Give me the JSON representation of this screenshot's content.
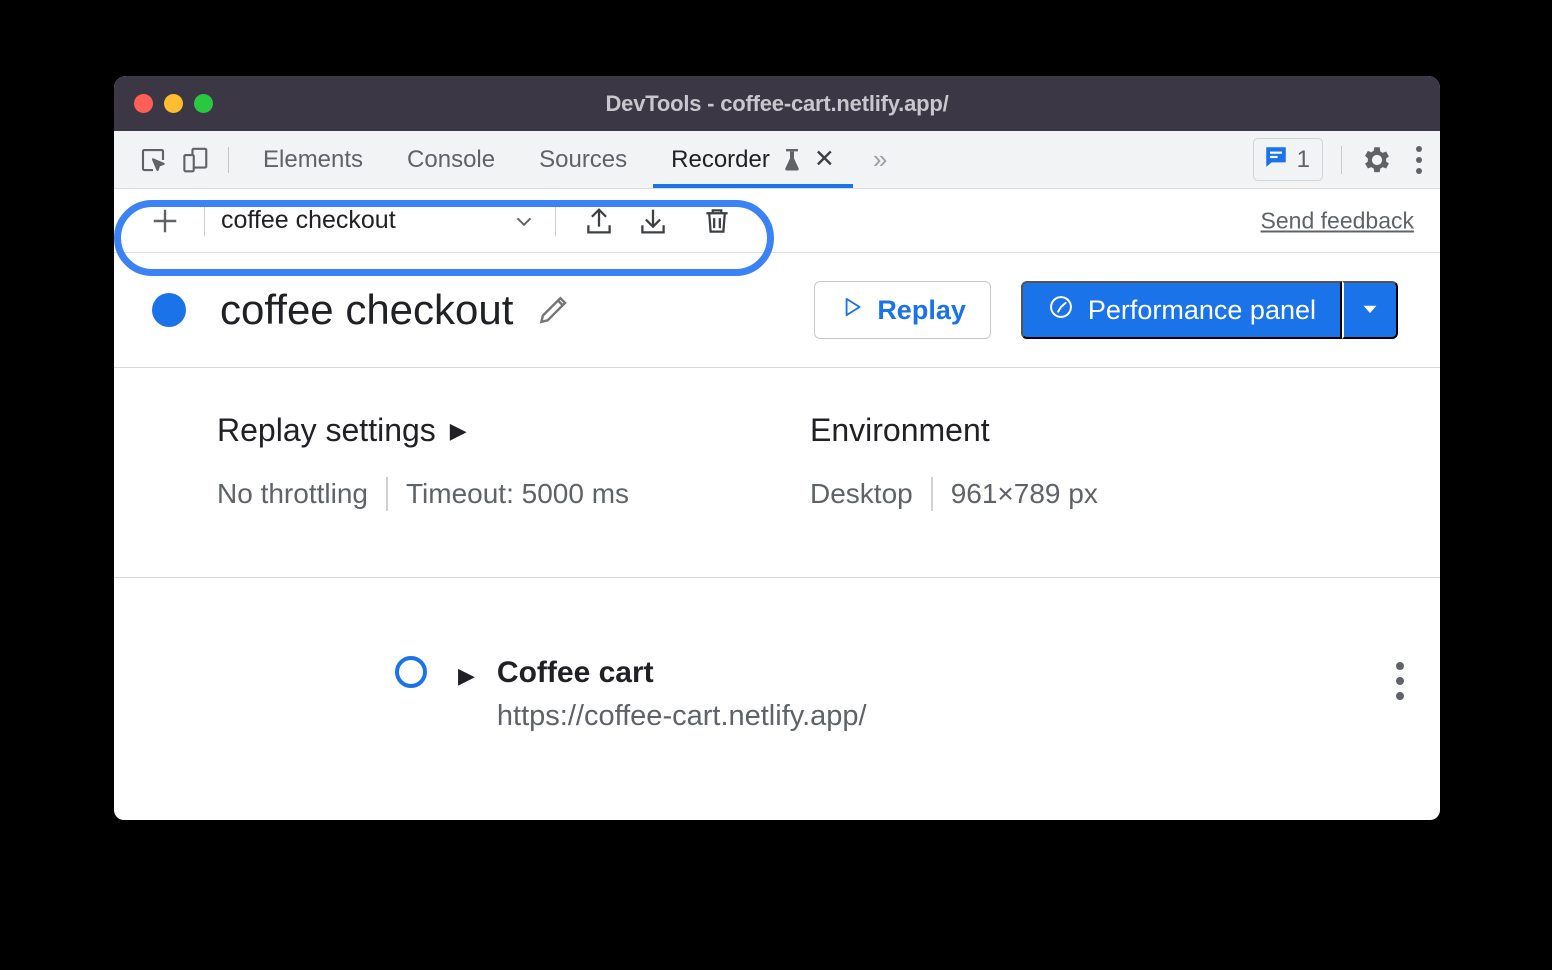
{
  "window": {
    "title": "DevTools - coffee-cart.netlify.app/",
    "traffic_lights": [
      "close",
      "minimize",
      "zoom"
    ]
  },
  "tabbar": {
    "inspect_icon": "inspect-element-icon",
    "device_icon": "device-toolbar-icon",
    "tabs": [
      {
        "label": "Elements",
        "active": false
      },
      {
        "label": "Console",
        "active": false
      },
      {
        "label": "Sources",
        "active": false
      },
      {
        "label": "Recorder",
        "active": true,
        "experimental_icon": "flask-icon",
        "closable": true
      }
    ],
    "close_label": "×",
    "more_tabs_label": "»",
    "messages_count": "1",
    "messages_icon": "message-icon",
    "settings_icon": "gear-icon",
    "more_options_icon": "kebab-menu-icon"
  },
  "recorder_toolbar": {
    "add_label": "+",
    "add_icon": "plus-icon",
    "selected_recording": "coffee checkout",
    "dropdown_icon": "chevron-down-icon",
    "export_icon": "export-upload-icon",
    "import_icon": "import-download-icon",
    "delete_icon": "trash-icon",
    "feedback_label": "Send feedback",
    "highlight_color": "#3b82f6"
  },
  "recording_header": {
    "status_dot_color": "#1a73e8",
    "title": "coffee checkout",
    "edit_icon": "pencil-icon",
    "replay_label": "Replay",
    "replay_icon": "play-triangle-icon",
    "performance_label": "Performance panel",
    "performance_icon": "gauge-icon",
    "performance_dropdown_icon": "caret-down-icon",
    "accent_color": "#1a73e8"
  },
  "settings": {
    "replay": {
      "heading": "Replay settings",
      "expander_icon": "triangle-right-icon",
      "throttling": "No throttling",
      "timeout": "Timeout: 5000 ms"
    },
    "environment": {
      "heading": "Environment",
      "device": "Desktop",
      "viewport": "961×789 px"
    }
  },
  "steps": [
    {
      "marker": "start-marker",
      "expander_icon": "triangle-right-icon",
      "title": "Coffee cart",
      "url": "https://coffee-cart.netlify.app/",
      "menu_icon": "kebab-menu-icon"
    }
  ]
}
